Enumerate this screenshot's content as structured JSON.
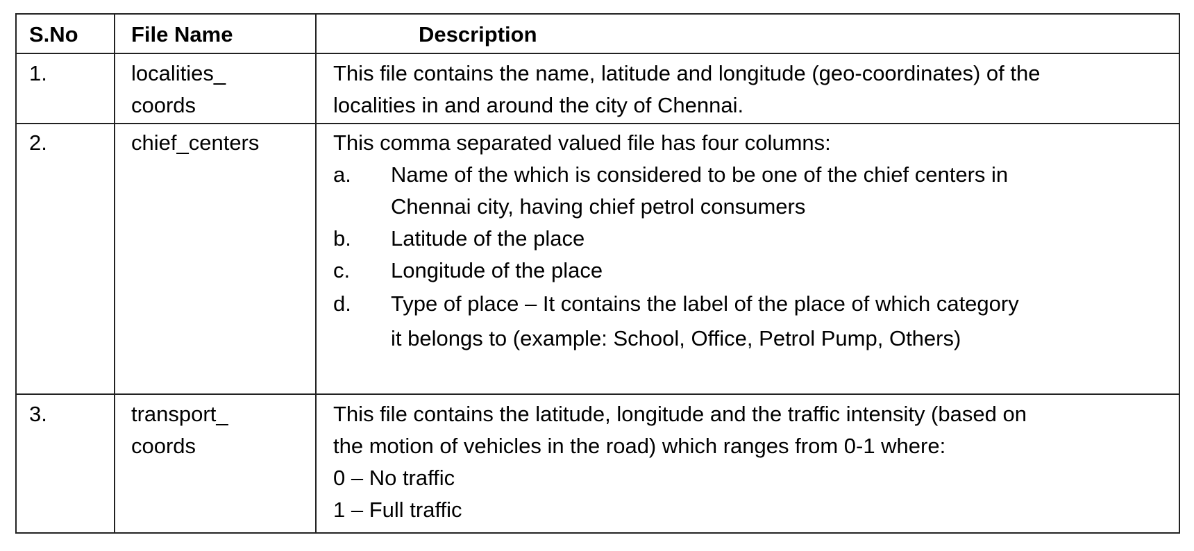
{
  "table": {
    "headers": {
      "sno": "S.No",
      "file_name": "File Name",
      "description": "Description"
    },
    "rows": [
      {
        "sno": "1.",
        "file_name": [
          "localities_",
          "coords"
        ],
        "description_lines": [
          "This file contains the name, latitude and longitude (geo-coordinates) of the",
          "localities in and around the city of Chennai."
        ]
      },
      {
        "sno": "2.",
        "file_name": [
          "chief_centers"
        ],
        "description_intro": "This comma separated valued file has four columns:",
        "list": [
          {
            "marker": "a.",
            "lines": [
              "Name of the which is considered to be one of the chief centers in",
              "Chennai city, having chief petrol consumers"
            ]
          },
          {
            "marker": "b.",
            "lines": [
              "Latitude of the place"
            ]
          },
          {
            "marker": "c.",
            "lines": [
              "Longitude of the place"
            ]
          },
          {
            "marker": "d.",
            "lines": [
              "Type of place – It contains the label of the place of which category",
              "it belongs to (example: School, Office, Petrol Pump, Others)"
            ]
          }
        ]
      },
      {
        "sno": "3.",
        "file_name": [
          "transport_",
          "coords"
        ],
        "description_lines": [
          "This file contains the latitude, longitude and the traffic intensity (based on",
          "the motion of vehicles in the road) which ranges from 0-1 where:",
          "0 – No traffic",
          "1 – Full traffic"
        ]
      }
    ]
  }
}
